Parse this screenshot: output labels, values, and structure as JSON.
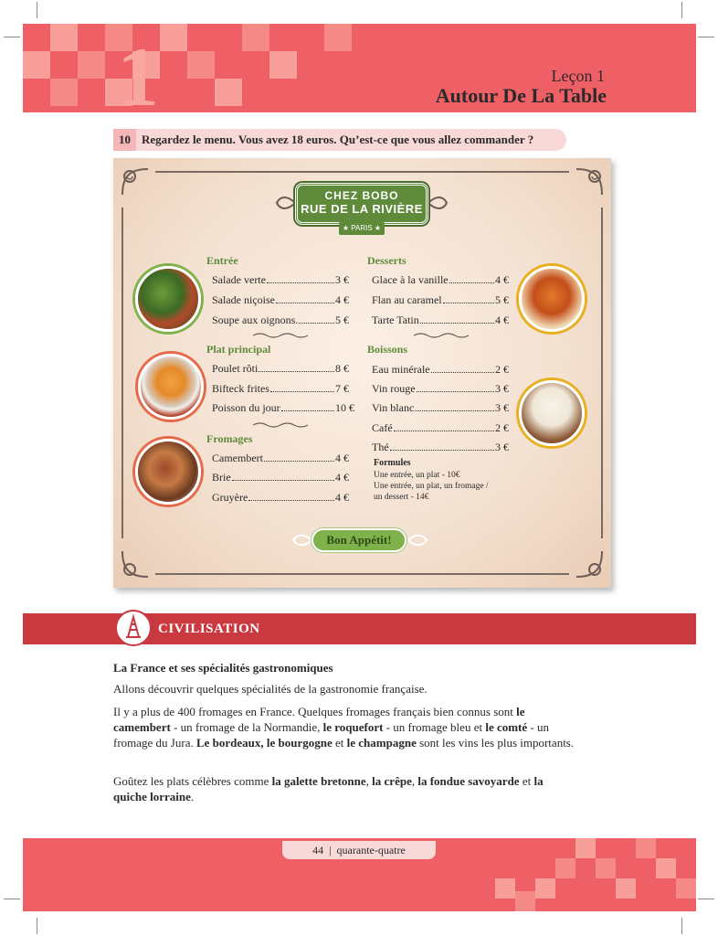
{
  "header": {
    "chapter_number": "1",
    "lesson_label": "Leçon 1",
    "lesson_title": "Autour De La Table"
  },
  "exercise": {
    "number": "10",
    "instruction": "Regardez le menu. Vous avez 18 euros. Qu’est-ce que vous allez commander ?"
  },
  "menu": {
    "restaurant_line1": "CHEZ BOBO",
    "restaurant_line2": "RUE DE LA RIVIÈRE",
    "city": "★ PARIS ★",
    "sections": [
      {
        "title": "Entrée",
        "items": [
          {
            "name": "Salade verte",
            "price": "3 €"
          },
          {
            "name": "Salade niçoise",
            "price": "4 €"
          },
          {
            "name": "Soupe aux oignons.",
            "price": "5 €"
          }
        ]
      },
      {
        "title": "Plat principal",
        "items": [
          {
            "name": "Poulet rôti",
            "price": "8 €"
          },
          {
            "name": "Bifteck frites",
            "price": "7 €"
          },
          {
            "name": "Poisson du jour",
            "price": "10 €"
          }
        ]
      },
      {
        "title": "Fromages",
        "items": [
          {
            "name": "Camembert",
            "price": "4 €"
          },
          {
            "name": "Brie",
            "price": "4 €"
          },
          {
            "name": "Gruyère",
            "price": "4 €"
          }
        ]
      },
      {
        "title": "Desserts",
        "items": [
          {
            "name": "Glace à la vanille",
            "price": "4 €"
          },
          {
            "name": "Flan au caramel",
            "price": "5 €"
          },
          {
            "name": "Tarte Tatin",
            "price": "4 €"
          }
        ]
      },
      {
        "title": "Boissons",
        "items": [
          {
            "name": "Eau minérale",
            "price": "2 €"
          },
          {
            "name": "Vin rouge",
            "price": "3 €"
          },
          {
            "name": "Vin blanc",
            "price": "3 €"
          },
          {
            "name": "Café",
            "price": "2 €"
          },
          {
            "name": "Thé",
            "price": "3 €"
          }
        ]
      }
    ],
    "formules_title": "Formules",
    "formules": [
      "Une entrée, un plat - 10€",
      "Une entrée, un plat, un fromage /",
      "un dessert - 14€"
    ],
    "closing": "Bon Appétit!"
  },
  "civilisation": {
    "band_title": "CIVILISATION",
    "heading": "La France et ses spécialités gastronomiques",
    "intro": "Allons découvrir quelques spécialités de la gastronomie française.",
    "p1": [
      {
        "t": "Il y a plus de 400 fromages en France. Quelques fromages français bien connus sont ",
        "b": false
      },
      {
        "t": "le camembert",
        "b": true
      },
      {
        "t": " - un fromage de la Normandie, ",
        "b": false
      },
      {
        "t": "le roquefort",
        "b": true
      },
      {
        "t": " - un fromage bleu et ",
        "b": false
      },
      {
        "t": "le comté",
        "b": true
      },
      {
        "t": " - un fromage du Jura. ",
        "b": false
      },
      {
        "t": "Le bordeaux, le bourgogne",
        "b": true
      },
      {
        "t": " et ",
        "b": false
      },
      {
        "t": "le champagne",
        "b": true
      },
      {
        "t": " sont les vins les plus importants.",
        "b": false
      }
    ],
    "p2": [
      {
        "t": "Goûtez les plats célèbres comme ",
        "b": false
      },
      {
        "t": "la galette bretonne",
        "b": true
      },
      {
        "t": ", ",
        "b": false
      },
      {
        "t": "la crêpe",
        "b": true
      },
      {
        "t": ", ",
        "b": false
      },
      {
        "t": "la fondue savoyarde",
        "b": true
      },
      {
        "t": " et ",
        "b": false
      },
      {
        "t": "la quiche lorraine",
        "b": true
      },
      {
        "t": ".",
        "b": false
      }
    ]
  },
  "footer": {
    "page_number": "44",
    "separator": "|",
    "page_words": "quarante-quatre"
  },
  "colors": {
    "band": "#ef5f66",
    "civilisation": "#c93a40",
    "menu_green": "#5e8a3a"
  }
}
